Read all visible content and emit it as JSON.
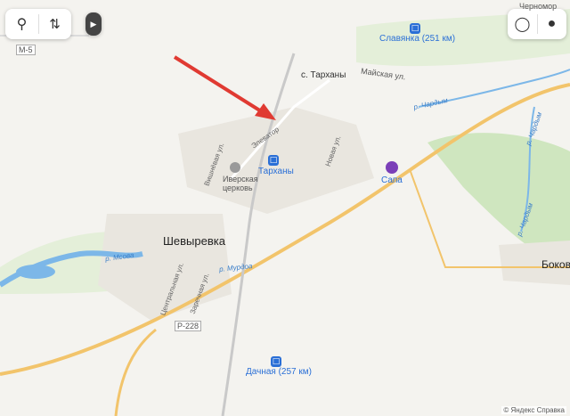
{
  "toolbar": {
    "search_icon": "search-icon",
    "route_icon": "route-icon",
    "menu_icon": "play-triangle-icon",
    "layers_icon": "layers-icon"
  },
  "places": {
    "shevyrevka": "Шевыревка",
    "tarkhany_village": "с. Тарханы",
    "tarkhany_station": "Тарханы",
    "slavyanka": "Славянка (251 км)",
    "dachnaya": "Дачная (257 км)",
    "bokov": "Боков",
    "chernomor": "Черномор",
    "iverskaya": "Иверская\nцерковь",
    "sapa": "Сапа"
  },
  "roads": {
    "m5": "М-5",
    "r228": "Р-228",
    "mayskaya": "Майская ул.",
    "tsentralnaya": "Центральная ул.",
    "zarechnaya": "Заречная ул.",
    "vishnevaya": "Вишнёвая ул.",
    "novaya": "Новая ул.",
    "elevator": "Элеватор"
  },
  "water": {
    "mostovaya_1": "р. Мсова",
    "mostovaya_2": "р. Мурдоа",
    "chardym_1": "р. Чардым",
    "chardym_2": "р. Чардым",
    "chardym_3": "р. Чардым"
  },
  "footer": {
    "brand": "© Яндекс",
    "help": "Справка"
  },
  "colors": {
    "land": "#f4f3ef",
    "green": "#cfe6bf",
    "highway": "#f2c46b",
    "rail": "#c9c9c9",
    "water": "#7cb7e8",
    "arrow": "#e03a32"
  }
}
